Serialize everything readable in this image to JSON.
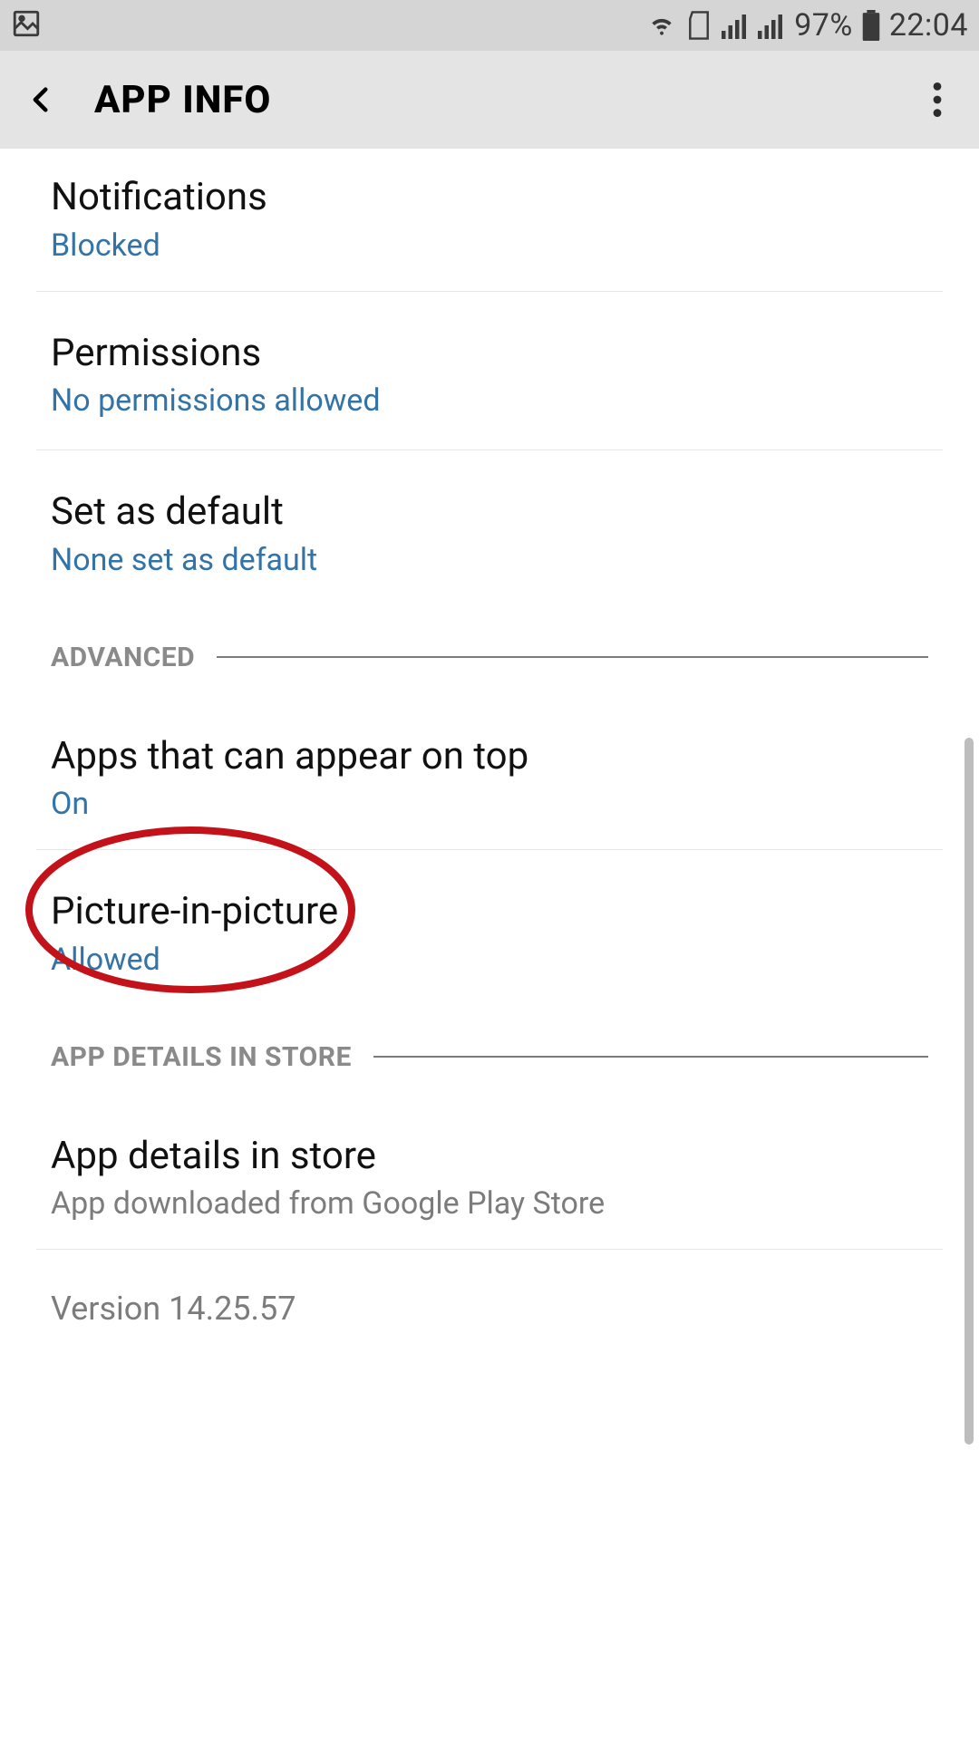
{
  "status": {
    "battery_pct": "97%",
    "time": "22:04"
  },
  "header": {
    "title": "APP INFO"
  },
  "rows": {
    "notifications": {
      "title": "Notifications",
      "sub": "Blocked"
    },
    "permissions": {
      "title": "Permissions",
      "sub": "No permissions allowed"
    },
    "default": {
      "title": "Set as default",
      "sub": "None set as default"
    },
    "ontop": {
      "title": "Apps that can appear on top",
      "sub": "On"
    },
    "pip": {
      "title": "Picture-in-picture",
      "sub": "Allowed"
    },
    "store": {
      "title": "App details in store",
      "sub": "App downloaded from Google Play Store"
    }
  },
  "sections": {
    "advanced": "ADVANCED",
    "store": "APP DETAILS IN STORE"
  },
  "version": "Version 14.25.57"
}
